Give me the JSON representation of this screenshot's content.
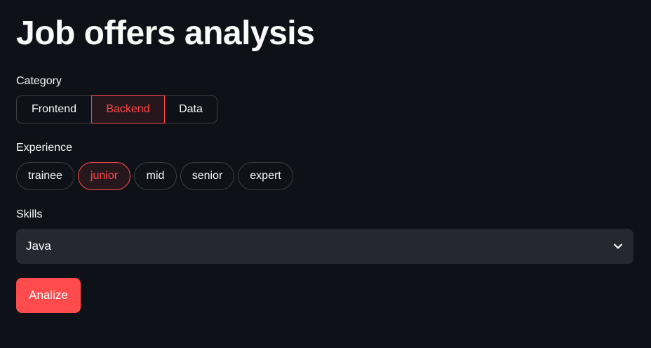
{
  "page": {
    "title": "Job offers analysis"
  },
  "category": {
    "label": "Category",
    "options": [
      "Frontend",
      "Backend",
      "Data"
    ],
    "selected": "Backend"
  },
  "experience": {
    "label": "Experience",
    "options": [
      "trainee",
      "junior",
      "mid",
      "senior",
      "expert"
    ],
    "selected": "junior"
  },
  "skills": {
    "label": "Skills",
    "value": "Java",
    "icon": "chevron-down-icon"
  },
  "actions": {
    "analyze_label": "Analize"
  },
  "colors": {
    "background": "#0e1117",
    "accent": "#ff4b4b",
    "text": "#fafafa",
    "input_background": "#262730"
  }
}
